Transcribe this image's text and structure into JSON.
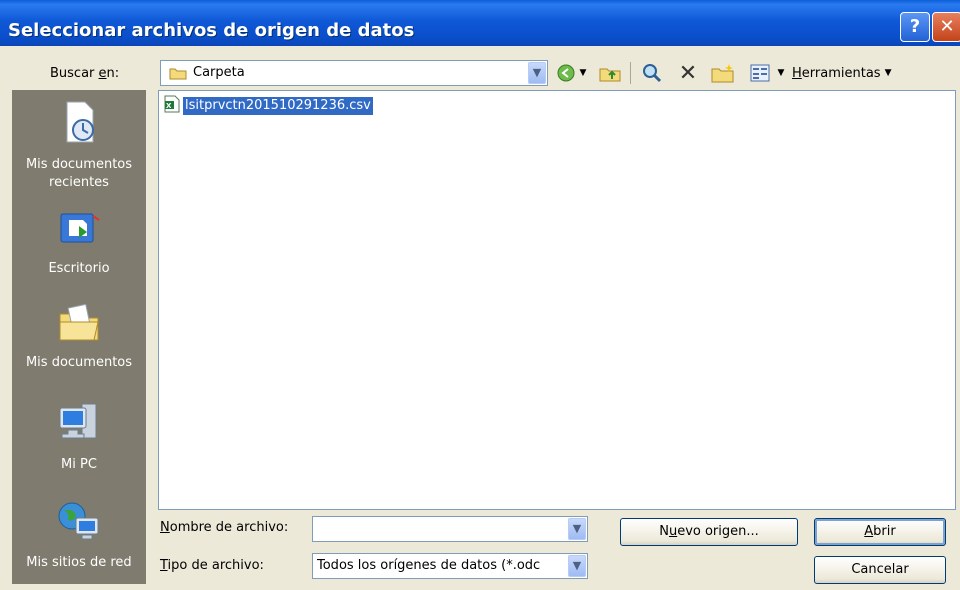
{
  "window": {
    "title": "Seleccionar archivos de origen de datos",
    "help_glyph": "?",
    "close_glyph": "✕"
  },
  "lookin": {
    "label_pre": "Buscar ",
    "label_key": "e",
    "label_post": "n:",
    "value": "Carpeta"
  },
  "toolbar": {
    "icons": [
      "back-icon",
      "up-folder-icon",
      "search-web-icon",
      "delete-icon",
      "new-folder-icon",
      "views-icon"
    ],
    "tools_key": "H",
    "tools_rest": "erramientas"
  },
  "places": [
    {
      "line1": "Mis documentos",
      "line2": "recientes",
      "icon": "recent-documents-icon"
    },
    {
      "line1": "Escritorio",
      "line2": "",
      "icon": "desktop-icon"
    },
    {
      "line1": "Mis documentos",
      "line2": "",
      "icon": "my-documents-icon"
    },
    {
      "line1": "Mi PC",
      "line2": "",
      "icon": "my-computer-icon"
    },
    {
      "line1": "Mis sitios de red",
      "line2": "",
      "icon": "network-places-icon"
    }
  ],
  "files": [
    {
      "name": "lsitprvctn201510291236.csv",
      "icon": "csv-file-icon",
      "selected": true
    }
  ],
  "filename": {
    "label_key": "N",
    "label_rest": "ombre de archivo:",
    "value": ""
  },
  "filetype": {
    "label_key": "T",
    "label_rest": "ipo de archivo:",
    "value": "Todos los orígenes de datos (*.odc"
  },
  "buttons": {
    "new_source_pre": "N",
    "new_source_key": "u",
    "new_source_post": "evo origen...",
    "open_key": "A",
    "open_rest": "brir",
    "cancel": "Cancelar"
  },
  "colors": {
    "titlebar": "#0a5fd8",
    "places_bg": "#7f7c6f",
    "selection": "#316ac5",
    "dialog_bg": "#ece9d8"
  }
}
